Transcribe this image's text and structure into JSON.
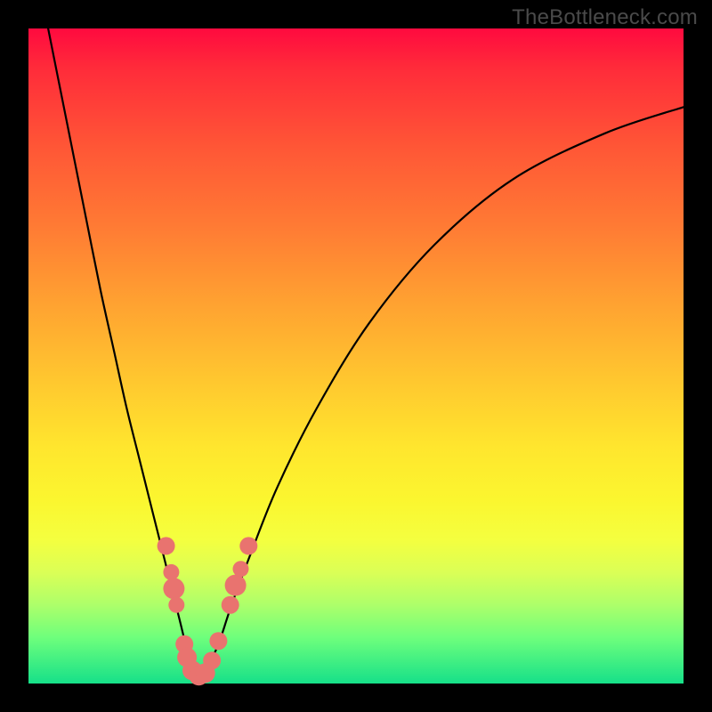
{
  "watermark": "TheBottleneck.com",
  "chart_data": {
    "type": "line",
    "title": "",
    "xlabel": "",
    "ylabel": "",
    "xlim": [
      0,
      100
    ],
    "ylim": [
      0,
      100
    ],
    "series": [
      {
        "name": "bottleneck-curve",
        "x": [
          3,
          5,
          7,
          9,
          11,
          13,
          15,
          17,
          19,
          21,
          23,
          24,
          25,
          26,
          27,
          29,
          31,
          34,
          38,
          44,
          52,
          62,
          74,
          88,
          100
        ],
        "y": [
          100,
          90,
          80,
          70,
          60,
          51,
          42,
          34,
          26,
          18,
          10,
          6,
          3,
          1,
          2,
          6,
          12,
          20,
          30,
          42,
          55,
          67,
          77,
          84,
          88
        ]
      }
    ],
    "markers": {
      "name": "highlight-dots",
      "color": "#e9736f",
      "points": [
        {
          "x": 21.0,
          "y": 21.0,
          "r": 10
        },
        {
          "x": 21.8,
          "y": 17.0,
          "r": 9
        },
        {
          "x": 22.2,
          "y": 14.5,
          "r": 12
        },
        {
          "x": 22.6,
          "y": 12.0,
          "r": 9
        },
        {
          "x": 23.8,
          "y": 6.0,
          "r": 10
        },
        {
          "x": 24.2,
          "y": 4.0,
          "r": 11
        },
        {
          "x": 25.0,
          "y": 2.0,
          "r": 11
        },
        {
          "x": 26.0,
          "y": 1.2,
          "r": 11
        },
        {
          "x": 27.0,
          "y": 1.6,
          "r": 11
        },
        {
          "x": 28.0,
          "y": 3.5,
          "r": 10
        },
        {
          "x": 29.0,
          "y": 6.5,
          "r": 10
        },
        {
          "x": 30.8,
          "y": 12.0,
          "r": 10
        },
        {
          "x": 31.6,
          "y": 15.0,
          "r": 12
        },
        {
          "x": 32.4,
          "y": 17.5,
          "r": 9
        },
        {
          "x": 33.6,
          "y": 21.0,
          "r": 10
        }
      ]
    }
  }
}
